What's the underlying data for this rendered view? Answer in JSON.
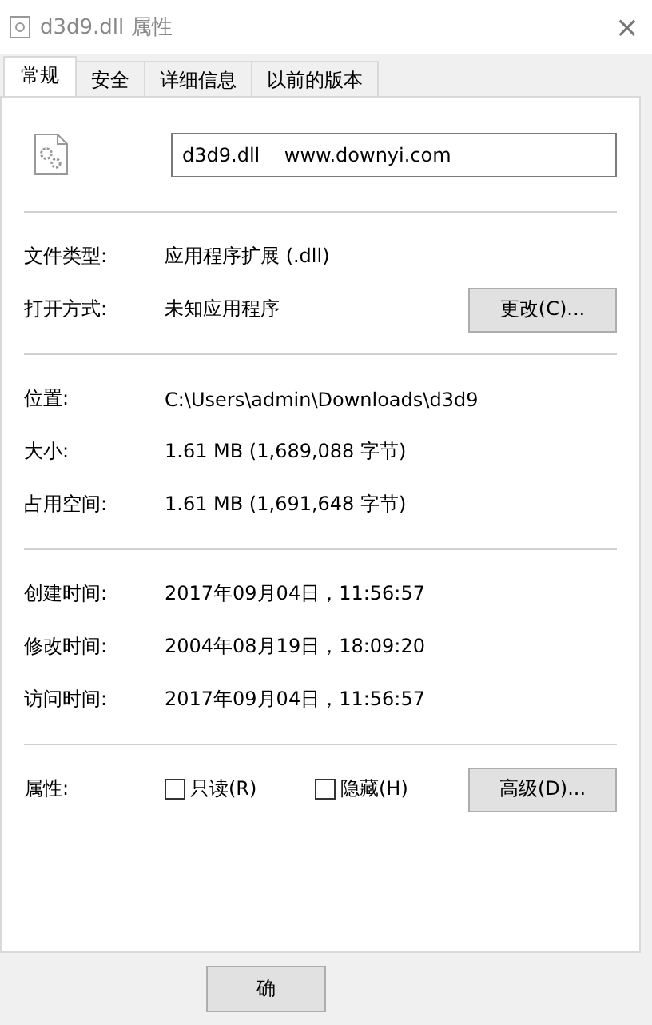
{
  "window": {
    "title": "d3d9.dll 属性",
    "close": "×"
  },
  "tabs": [
    {
      "label": "常规",
      "selected": true
    },
    {
      "label": "安全",
      "selected": false
    },
    {
      "label": "详细信息",
      "selected": false
    },
    {
      "label": "以前的版本",
      "selected": false
    }
  ],
  "file_name": {
    "value": "d3d9.dll    www.downyi.com"
  },
  "sections": [
    {
      "rows": [
        {
          "label": "文件类型:",
          "value": "应用程序扩展 (.dll)"
        },
        {
          "label": "打开方式:",
          "value": "未知应用程序",
          "button": "更改(C)..."
        }
      ]
    },
    {
      "rows": [
        {
          "label": "位置:",
          "value": "C:\\Users\\admin\\Downloads\\d3d9"
        },
        {
          "label": "大小:",
          "value": "1.61 MB (1,689,088 字节)"
        },
        {
          "label": "占用空间:",
          "value": "1.61 MB (1,691,648 字节)"
        }
      ]
    },
    {
      "rows": [
        {
          "label": "创建时间:",
          "value": "2017年09月04日，11:56:57"
        },
        {
          "label": "修改时间:",
          "value": "2004年08月19日，18:09:20"
        },
        {
          "label": "访问时间:",
          "value": "2017年09月04日，11:56:57"
        }
      ]
    }
  ],
  "attributes": {
    "label": "属性:",
    "checkboxes": [
      {
        "label": "只读(R)",
        "checked": false
      },
      {
        "label": "隐藏(H)",
        "checked": false
      }
    ],
    "button": "高级(D)..."
  },
  "footer_buttons": [
    "确"
  ]
}
